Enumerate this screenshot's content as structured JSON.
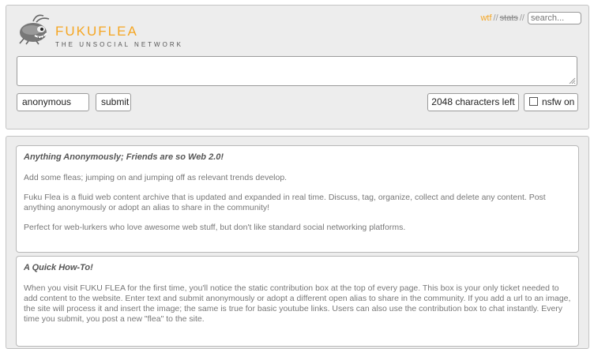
{
  "header": {
    "brand_name": "FUKUFLEA",
    "tagline": "THE UNSOCIAL NETWORK",
    "logo_icon": "flea-mascot-icon"
  },
  "topnav": {
    "wtf_label": "wtf",
    "separator": "//",
    "stats_label": "stats",
    "search_placeholder": "search..."
  },
  "contribution": {
    "text_value": "",
    "alias_value": "anonymous",
    "submit_label": "submit",
    "chars_left_label": "2048 characters left",
    "nsfw_label": "nsfw on",
    "nsfw_checked": false
  },
  "cards": [
    {
      "title": "Anything Anonymously; Friends are so Web 2.0!",
      "paragraphs": [
        "Add some fleas; jumping on and jumping off as relevant trends develop.",
        "Fuku Flea is a fluid web content archive that is updated and expanded in real time. Discuss, tag, organize, collect and delete any content. Post anything anonymously or adopt an alias to share in the community!",
        "Perfect for web-lurkers who love awesome web stuff, but don't like standard social networking platforms."
      ]
    },
    {
      "title": "A Quick How-To!",
      "paragraphs": [
        "When you visit FUKU FLEA for the first time, you'll notice the static contribution box at the top of every page. This box is your only ticket needed to add content to the website. Enter text and submit anonymously or adopt a different open alias to share in the community. If you add a url to an image, the site will process it and insert the image; the same is true for basic youtube links. Users can also use the contribution box to chat instantly. Every time you submit, you post a new \"flea\" to the site."
      ]
    }
  ],
  "colors": {
    "accent": "#f5a623",
    "panel_bg": "#ededed",
    "border": "#c4c4c4"
  }
}
